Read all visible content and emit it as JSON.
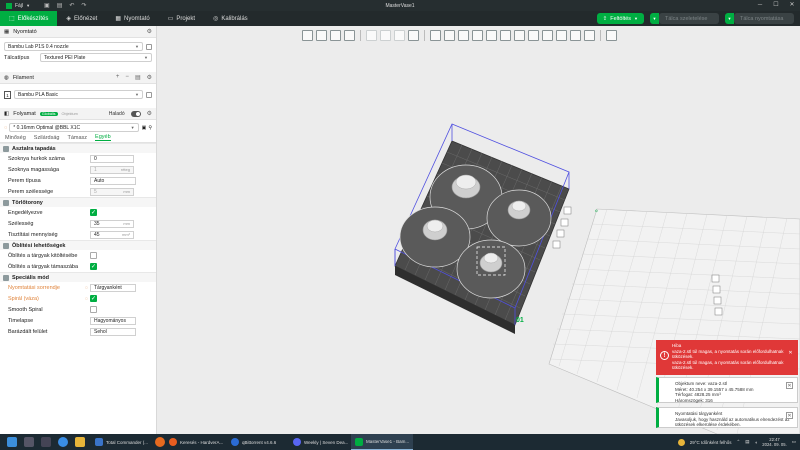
{
  "titlebar": {
    "menu": "Fájl",
    "title": "MasterVase1"
  },
  "tabs": [
    {
      "label": "Előkészítés",
      "icon": "prepare-icon",
      "active": true
    },
    {
      "label": "Előnézet",
      "icon": "preview-icon",
      "active": false
    },
    {
      "label": "Nyomtató",
      "icon": "printer-icon",
      "active": false
    },
    {
      "label": "Projekt",
      "icon": "project-icon",
      "active": false
    },
    {
      "label": "Kalibrálás",
      "icon": "calibration-icon",
      "active": false
    }
  ],
  "actions": {
    "slice": "Feltöltés",
    "slice_plate": "Tálca szeletelése",
    "print_plate": "Tálca nyomtatása"
  },
  "printer": {
    "section_title": "Nyomtató",
    "printer_name": "Bambu Lab P1S 0.4 nozzle",
    "plate_label": "Tálcatípus",
    "plate_value": "Textured PEI Plate"
  },
  "filament": {
    "section_title": "Filament",
    "slot": "1",
    "name": "Bambu PLA Basic",
    "color": "#e8e8e8"
  },
  "process": {
    "section_title": "Folyamat",
    "toggle_global": "Globális",
    "toggle_object": "Objektum",
    "advanced_label": "Haladó",
    "profile": "* 0.16mm Optimal @BBL X1C",
    "subtabs": [
      "Minőség",
      "Szilárdság",
      "Támasz",
      "Egyéb"
    ],
    "active_subtab": 3
  },
  "categories": {
    "bed_adhesion": {
      "title": "Asztalra tapadás",
      "rows": [
        {
          "label": "Szoknya hurkok száma",
          "value": "0",
          "unit": ""
        },
        {
          "label": "Szoknya magassága",
          "value": "1",
          "unit": "réteg"
        },
        {
          "label": "Perem típusa",
          "value": "Auto",
          "unit": ""
        },
        {
          "label": "Perem szélessége",
          "value": "5",
          "unit": "mm"
        }
      ]
    },
    "prime_tower": {
      "title": "Törlőtorony",
      "rows": [
        {
          "label": "Engedélyezve",
          "checked": true
        },
        {
          "label": "Szélesség",
          "value": "35",
          "unit": "mm"
        },
        {
          "label": "Tisztítási mennyiség",
          "value": "45",
          "unit": "mm³"
        }
      ]
    },
    "flush": {
      "title": "Öblítési lehetőségek",
      "rows": [
        {
          "label": "Öblítés a tárgyak kitöltésébe",
          "checked": false
        },
        {
          "label": "Öblítés a tárgyak támaszába",
          "checked": true
        }
      ]
    },
    "special": {
      "title": "Speciális mód",
      "rows": [
        {
          "label": "Nyomtatási sorrendje",
          "value": "Tárgyanként"
        },
        {
          "label": "Spirál (váza)",
          "checked": true
        },
        {
          "label": "Smooth Spiral",
          "checked": false
        },
        {
          "label": "Timelapse",
          "value": "Hagyományos"
        },
        {
          "label": "Barázdált felület",
          "value": "Sehol"
        }
      ]
    }
  },
  "viewport": {
    "plate_id": "01"
  },
  "notifications": [
    {
      "type": "error",
      "title": "Hiba",
      "text": "vaza-2.stl túl magas, a nyomtatás során előfordulhatnak ütközések.\nvaza-2.stl túl magas, a nyomtatás során előfordulhatnak ütközések."
    },
    {
      "type": "info",
      "title": "Objektum neve: vaza-2.stl",
      "text": "Méret: 40.254 x 39.1557 x 45.7588 mm\nTérfogat: 4828.25 mm³\nHáromszögek: 316"
    },
    {
      "type": "info",
      "title": "Nyomtatási tárgyanként",
      "text": "Javasoljuk, hogy használd az automatikus elrendezést az ütközések elkerülése érdekében."
    }
  ],
  "taskbar": {
    "apps": [
      {
        "label": "Total Commander (...",
        "color": "#3a74c9"
      },
      {
        "label": "Keresés - HardverA...",
        "color": "#e85d20"
      },
      {
        "label": "qBittorrent v4.6.6",
        "color": "#2b6bd3"
      },
      {
        "label": "Weekly | Seven Dea...",
        "color": "#5865f2"
      },
      {
        "label": "MasterVase1 - Bam...",
        "color": "#00ae42"
      }
    ],
    "weather": "29°C  Időnként felhős",
    "time": "22:47",
    "date": "2024. 09. 05."
  }
}
